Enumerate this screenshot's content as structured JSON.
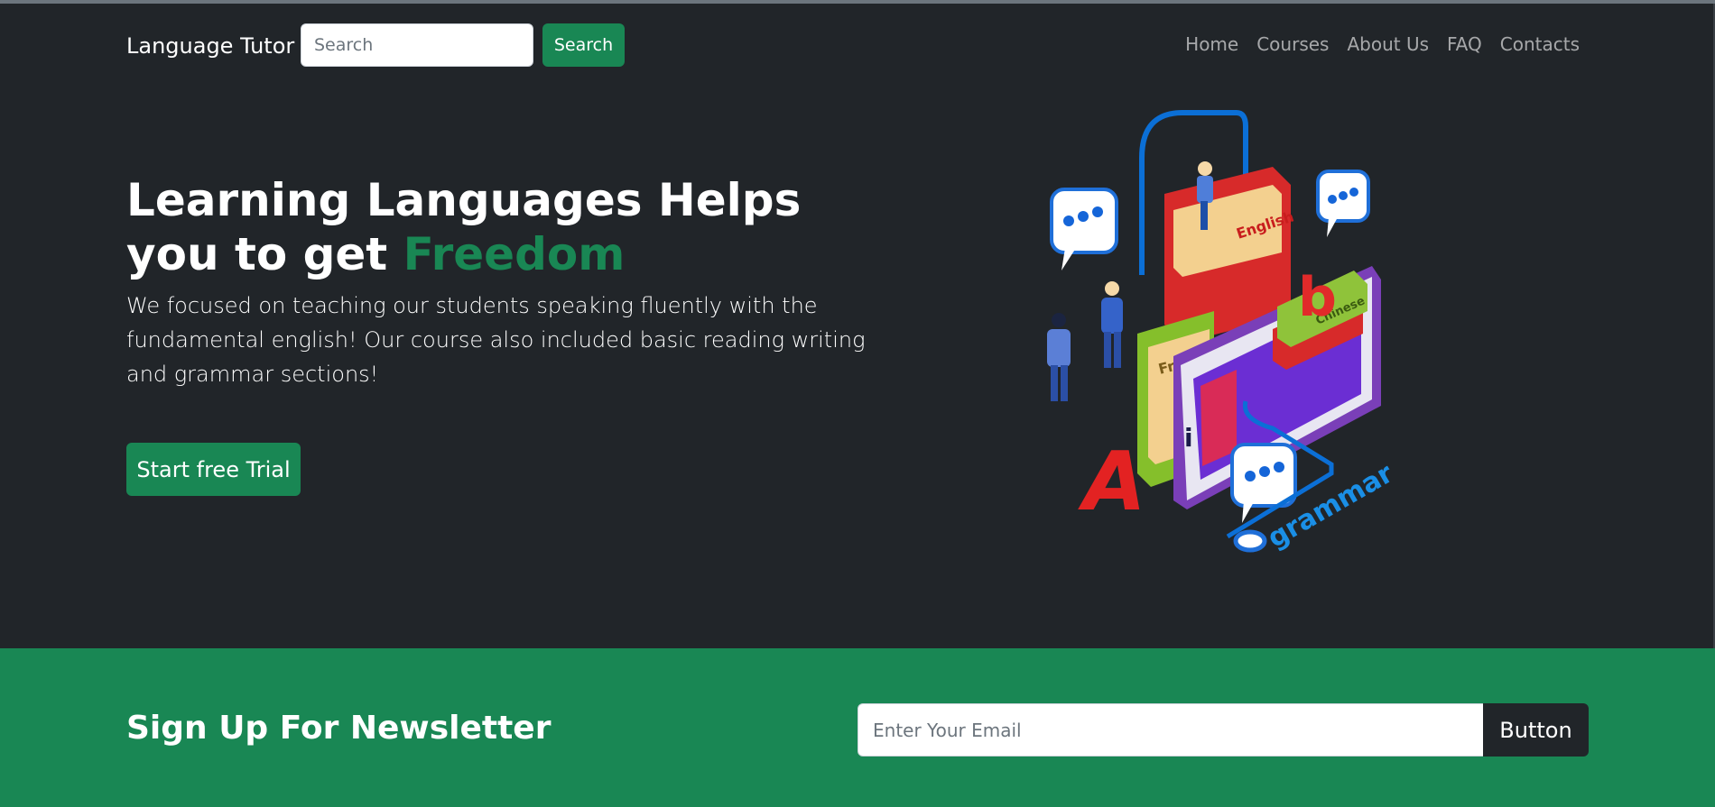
{
  "navbar": {
    "brand": "Language Tutor",
    "search_placeholder": "Search",
    "search_button": "Search",
    "links": [
      "Home",
      "Courses",
      "About Us",
      "FAQ",
      "Contacts"
    ]
  },
  "hero": {
    "title_main": "Learning Languages Helps you to get ",
    "title_accent": "Freedom",
    "description": "We focused on teaching our students speaking fluently with the fundamental english! Our course also included basic reading writing and grammar sections!",
    "cta_label": "Start free Trial"
  },
  "illustration": {
    "book_labels": [
      "English",
      "Chinese",
      "French"
    ],
    "letters": [
      "A",
      "b",
      "i"
    ],
    "word": "grammar"
  },
  "newsletter": {
    "title": "Sign Up For Newsletter",
    "email_placeholder": "Enter Your Email",
    "button_label": "Button"
  },
  "colors": {
    "background": "#212529",
    "accent": "#198754",
    "nav_link": "rgba(255,255,255,0.6)"
  }
}
